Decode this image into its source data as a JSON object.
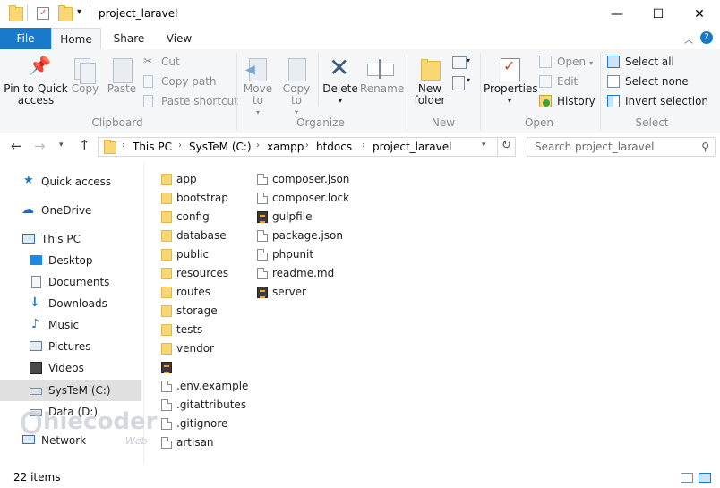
{
  "window": {
    "title": "project_laravel",
    "minimize": "—",
    "maximize": "☐",
    "close": "✕"
  },
  "tabs": [
    {
      "label": "File"
    },
    {
      "label": "Home"
    },
    {
      "label": "Share"
    },
    {
      "label": "View"
    }
  ],
  "ribbon": {
    "clipboard": {
      "label": "Clipboard",
      "pin": "Pin to Quick access",
      "copy": "Copy",
      "paste": "Paste",
      "cut": "Cut",
      "copy_path": "Copy path",
      "paste_shortcut": "Paste shortcut"
    },
    "organize": {
      "label": "Organize",
      "move_to": "Move to",
      "copy_to": "Copy to",
      "delete": "Delete",
      "rename": "Rename"
    },
    "new": {
      "label": "New",
      "new_folder": "New folder"
    },
    "open": {
      "label": "Open",
      "properties": "Properties",
      "open": "Open",
      "edit": "Edit",
      "history": "History"
    },
    "select": {
      "label": "Select",
      "select_all": "Select all",
      "select_none": "Select none",
      "invert": "Invert selection"
    }
  },
  "address": {
    "crumbs": [
      "This PC",
      "SysTeM (C:)",
      "xampp",
      "htdocs",
      "project_laravel"
    ],
    "search_placeholder": "Search project_laravel"
  },
  "nav": [
    {
      "label": "Quick access"
    },
    {
      "label": "OneDrive"
    },
    {
      "label": "This PC"
    },
    {
      "label": "Desktop"
    },
    {
      "label": "Documents"
    },
    {
      "label": "Downloads"
    },
    {
      "label": "Music"
    },
    {
      "label": "Pictures"
    },
    {
      "label": "Videos"
    },
    {
      "label": "SysTeM (C:)"
    },
    {
      "label": "Data (D:)"
    },
    {
      "label": "Network"
    }
  ],
  "files_col1": [
    {
      "name": "app"
    },
    {
      "name": "bootstrap"
    },
    {
      "name": "config"
    },
    {
      "name": "database"
    },
    {
      "name": "public"
    },
    {
      "name": "resources"
    },
    {
      "name": "routes"
    },
    {
      "name": "storage"
    },
    {
      "name": "tests"
    },
    {
      "name": "vendor"
    },
    {
      "name": ""
    },
    {
      "name": ".env.example"
    },
    {
      "name": ".gitattributes"
    },
    {
      "name": ".gitignore"
    },
    {
      "name": "artisan"
    }
  ],
  "files_col2": [
    {
      "name": "composer.json"
    },
    {
      "name": "composer.lock"
    },
    {
      "name": "gulpfile"
    },
    {
      "name": "package.json"
    },
    {
      "name": "phpunit"
    },
    {
      "name": "readme.md"
    },
    {
      "name": "server"
    }
  ],
  "status": {
    "count": "22 items"
  },
  "watermark": {
    "brand": "hiecoder",
    "suffix": "Web"
  }
}
